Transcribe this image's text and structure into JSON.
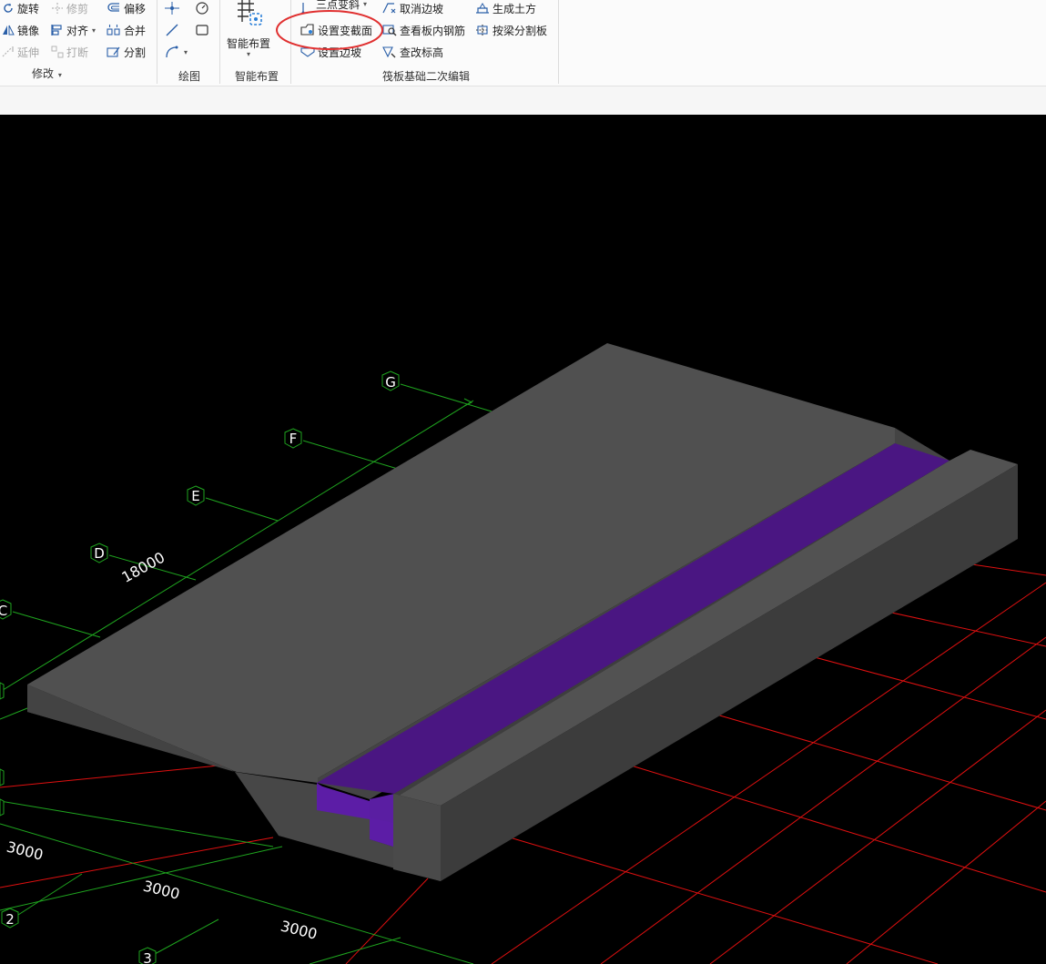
{
  "ribbon": {
    "groups": {
      "modify": {
        "label": "修改",
        "tools": {
          "rotate": "旋转",
          "trim": "修剪",
          "offset": "偏移",
          "mirror": "镜像",
          "align": "对齐",
          "merge": "合并",
          "extend": "延伸",
          "break": "打断",
          "split": "分割"
        }
      },
      "draw": {
        "label": "绘图"
      },
      "smart": {
        "label": "智能布置",
        "button": "智能布置"
      },
      "raft": {
        "label": "筏板基础二次编辑",
        "tools": {
          "three_point_slope": "三点变斜",
          "cancel_slope": "取消边坡",
          "generate_earthwork": "生成土方",
          "set_variable_section": "设置变截面",
          "view_rebar": "查看板内钢筋",
          "split_by_beam": "按梁分割板",
          "set_slope": "设置边坡",
          "edit_elevation": "查改标高"
        }
      }
    }
  },
  "viewport": {
    "background": "#000000",
    "axis_labels_letters": [
      "G",
      "F",
      "E",
      "D",
      "C"
    ],
    "axis_labels_numbers": [
      "2",
      "3"
    ],
    "dimensions": {
      "span_letters": "18000",
      "span_a": "3000",
      "span_b": "3000",
      "span_c": "3000"
    },
    "colors": {
      "grid_green": "#1fa51f",
      "grid_red": "#e01010",
      "slab_top": "#505050",
      "slab_side": "#3c3c3c",
      "variable_section": "#4a1682",
      "highlight": "#e03030"
    }
  }
}
